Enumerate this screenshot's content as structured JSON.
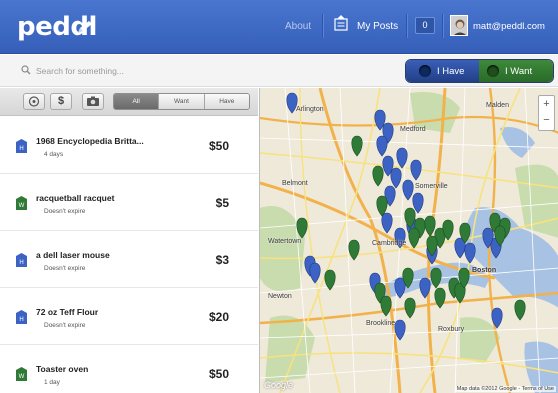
{
  "header": {
    "logo": "peddl",
    "nav_about": "About",
    "nav_posts": "My Posts",
    "posts_count": "0",
    "user_email": "matt@peddl.com"
  },
  "search": {
    "placeholder": "Search for something..."
  },
  "mode_toggle": {
    "have_label": "I Have",
    "want_label": "I Want",
    "have_color": "#2f4f9e",
    "want_color": "#347a32"
  },
  "filters": {
    "price_label": "$",
    "segments": [
      "All",
      "Want",
      "Have"
    ],
    "selected": "All"
  },
  "listings": [
    {
      "kind": "have",
      "badge": "H",
      "title": "1968 Encyclopedia Britta...",
      "expires": "4 days",
      "price": "$50"
    },
    {
      "kind": "want",
      "badge": "W",
      "title": "racquetball racquet",
      "expires": "Doesn't expire",
      "price": "$5"
    },
    {
      "kind": "have",
      "badge": "H",
      "title": "a dell laser mouse",
      "expires": "Doesn't expire",
      "price": "$3"
    },
    {
      "kind": "have",
      "badge": "H",
      "title": "72 oz Teff Flour",
      "expires": "Doesn't expire",
      "price": "$20"
    },
    {
      "kind": "want",
      "badge": "W",
      "title": "Toaster oven",
      "expires": "1 day",
      "price": "$50"
    }
  ],
  "map": {
    "zoom_in": "+",
    "zoom_out": "−",
    "labels": [
      "Arlington",
      "Medford",
      "Malden",
      "Belmont",
      "Somerville",
      "Watertown",
      "Cambridge",
      "Boston",
      "Brookline",
      "Roxbury",
      "Newton"
    ],
    "attribution": "Google",
    "copyright": "Map data ©2012 Google - Terms of Use",
    "marker_colors": {
      "have": "#3c63c4",
      "want": "#2f7a36"
    }
  }
}
